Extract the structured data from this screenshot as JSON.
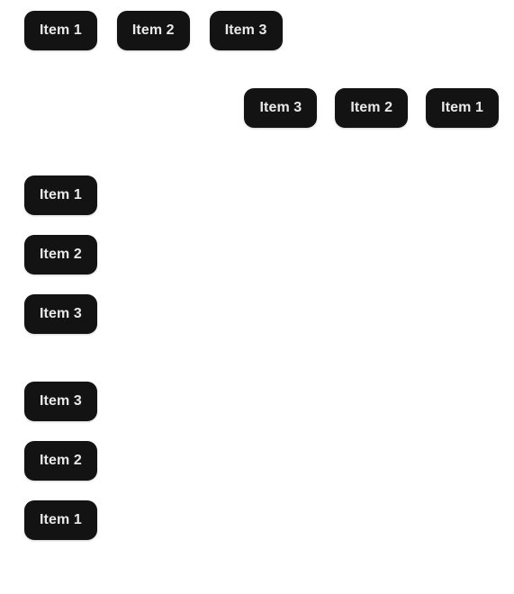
{
  "page": {
    "background_color": "#ffffff",
    "chip_background_color": "#131313",
    "chip_text_color": "#e9e9e9"
  },
  "groups": [
    {
      "name": "row",
      "direction": "row",
      "alignment": "left",
      "items": [
        {
          "label": "Item 1"
        },
        {
          "label": "Item 2"
        },
        {
          "label": "Item 3"
        }
      ]
    },
    {
      "name": "row-reverse",
      "direction": "row-reverse",
      "alignment": "right",
      "items": [
        {
          "label": "Item 1"
        },
        {
          "label": "Item 2"
        },
        {
          "label": "Item 3"
        }
      ]
    },
    {
      "name": "column",
      "direction": "column",
      "alignment": "left",
      "items": [
        {
          "label": "Item 1"
        },
        {
          "label": "Item 2"
        },
        {
          "label": "Item 3"
        }
      ]
    },
    {
      "name": "column-reverse",
      "direction": "column-reverse",
      "alignment": "left",
      "items": [
        {
          "label": "Item 1"
        },
        {
          "label": "Item 2"
        },
        {
          "label": "Item 3"
        }
      ]
    }
  ]
}
